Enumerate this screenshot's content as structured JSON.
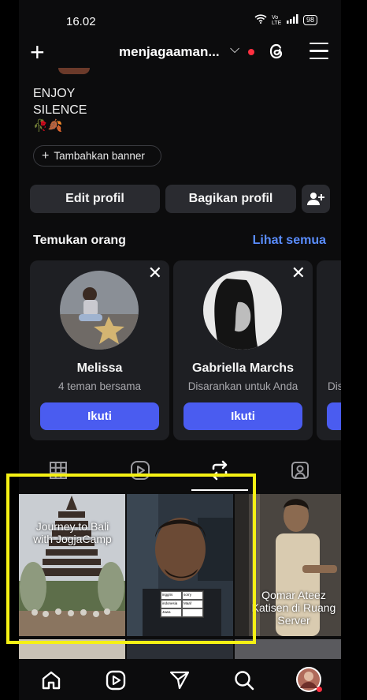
{
  "status": {
    "time": "16.02",
    "network": "Vo LTE",
    "battery": "98"
  },
  "header": {
    "username": "menjagaaman..."
  },
  "bio": {
    "line1": "ENJOY",
    "line2": "SILENCE",
    "emoji": "🥀🍂"
  },
  "banner_button": "Tambahkan banner",
  "actions": {
    "edit": "Edit profil",
    "share": "Bagikan profil"
  },
  "discover": {
    "title": "Temukan orang",
    "see_all": "Lihat semua",
    "cards": [
      {
        "name": "Melissa",
        "subtitle": "4 teman bersama",
        "follow": "Ikuti"
      },
      {
        "name": "Gabriella Marchs",
        "subtitle": "Disarankan untuk Anda",
        "follow": "Ikuti"
      },
      {
        "name": "",
        "subtitle": "Dis",
        "follow": ""
      }
    ]
  },
  "grid": {
    "tiles": [
      {
        "caption": "Journey to Bali with JogjaCamp"
      },
      {
        "caption": ""
      },
      {
        "caption": "Qomar Ateez Katisen di Ruang Server"
      }
    ],
    "table_cells": [
      "inggris",
      "sorry",
      "indonesia",
      "Maaf",
      "Jawa",
      ""
    ]
  },
  "colors": {
    "accent": "#4a5cf0",
    "link": "#5a8dff",
    "highlight": "#f5f114",
    "notification": "#ff3040"
  }
}
